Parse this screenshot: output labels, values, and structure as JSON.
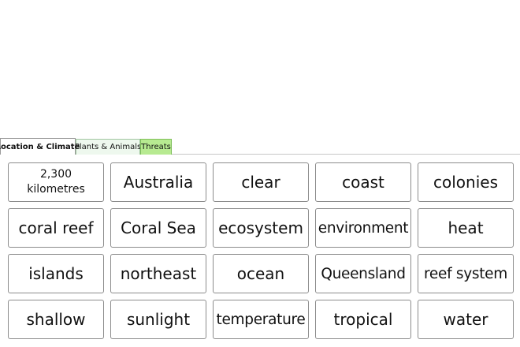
{
  "tabs": [
    {
      "label": "Location & Climate",
      "active": true
    },
    {
      "label": "Plants & Animals",
      "active": false
    },
    {
      "label": "Threats",
      "active": false
    }
  ],
  "colors": {
    "tab_plants_bg": "#eef8ee",
    "tab_threats_bg": "#b7ea91",
    "card_border": "#8c8c8c"
  },
  "words": [
    "2,300 kilometres",
    "Australia",
    "clear",
    "coast",
    "colonies",
    "coral reef",
    "Coral Sea",
    "ecosystem",
    "environment",
    "heat",
    "islands",
    "northeast",
    "ocean",
    "Queensland",
    "reef system",
    "shallow",
    "sunlight",
    "temperature",
    "tropical",
    "water"
  ]
}
